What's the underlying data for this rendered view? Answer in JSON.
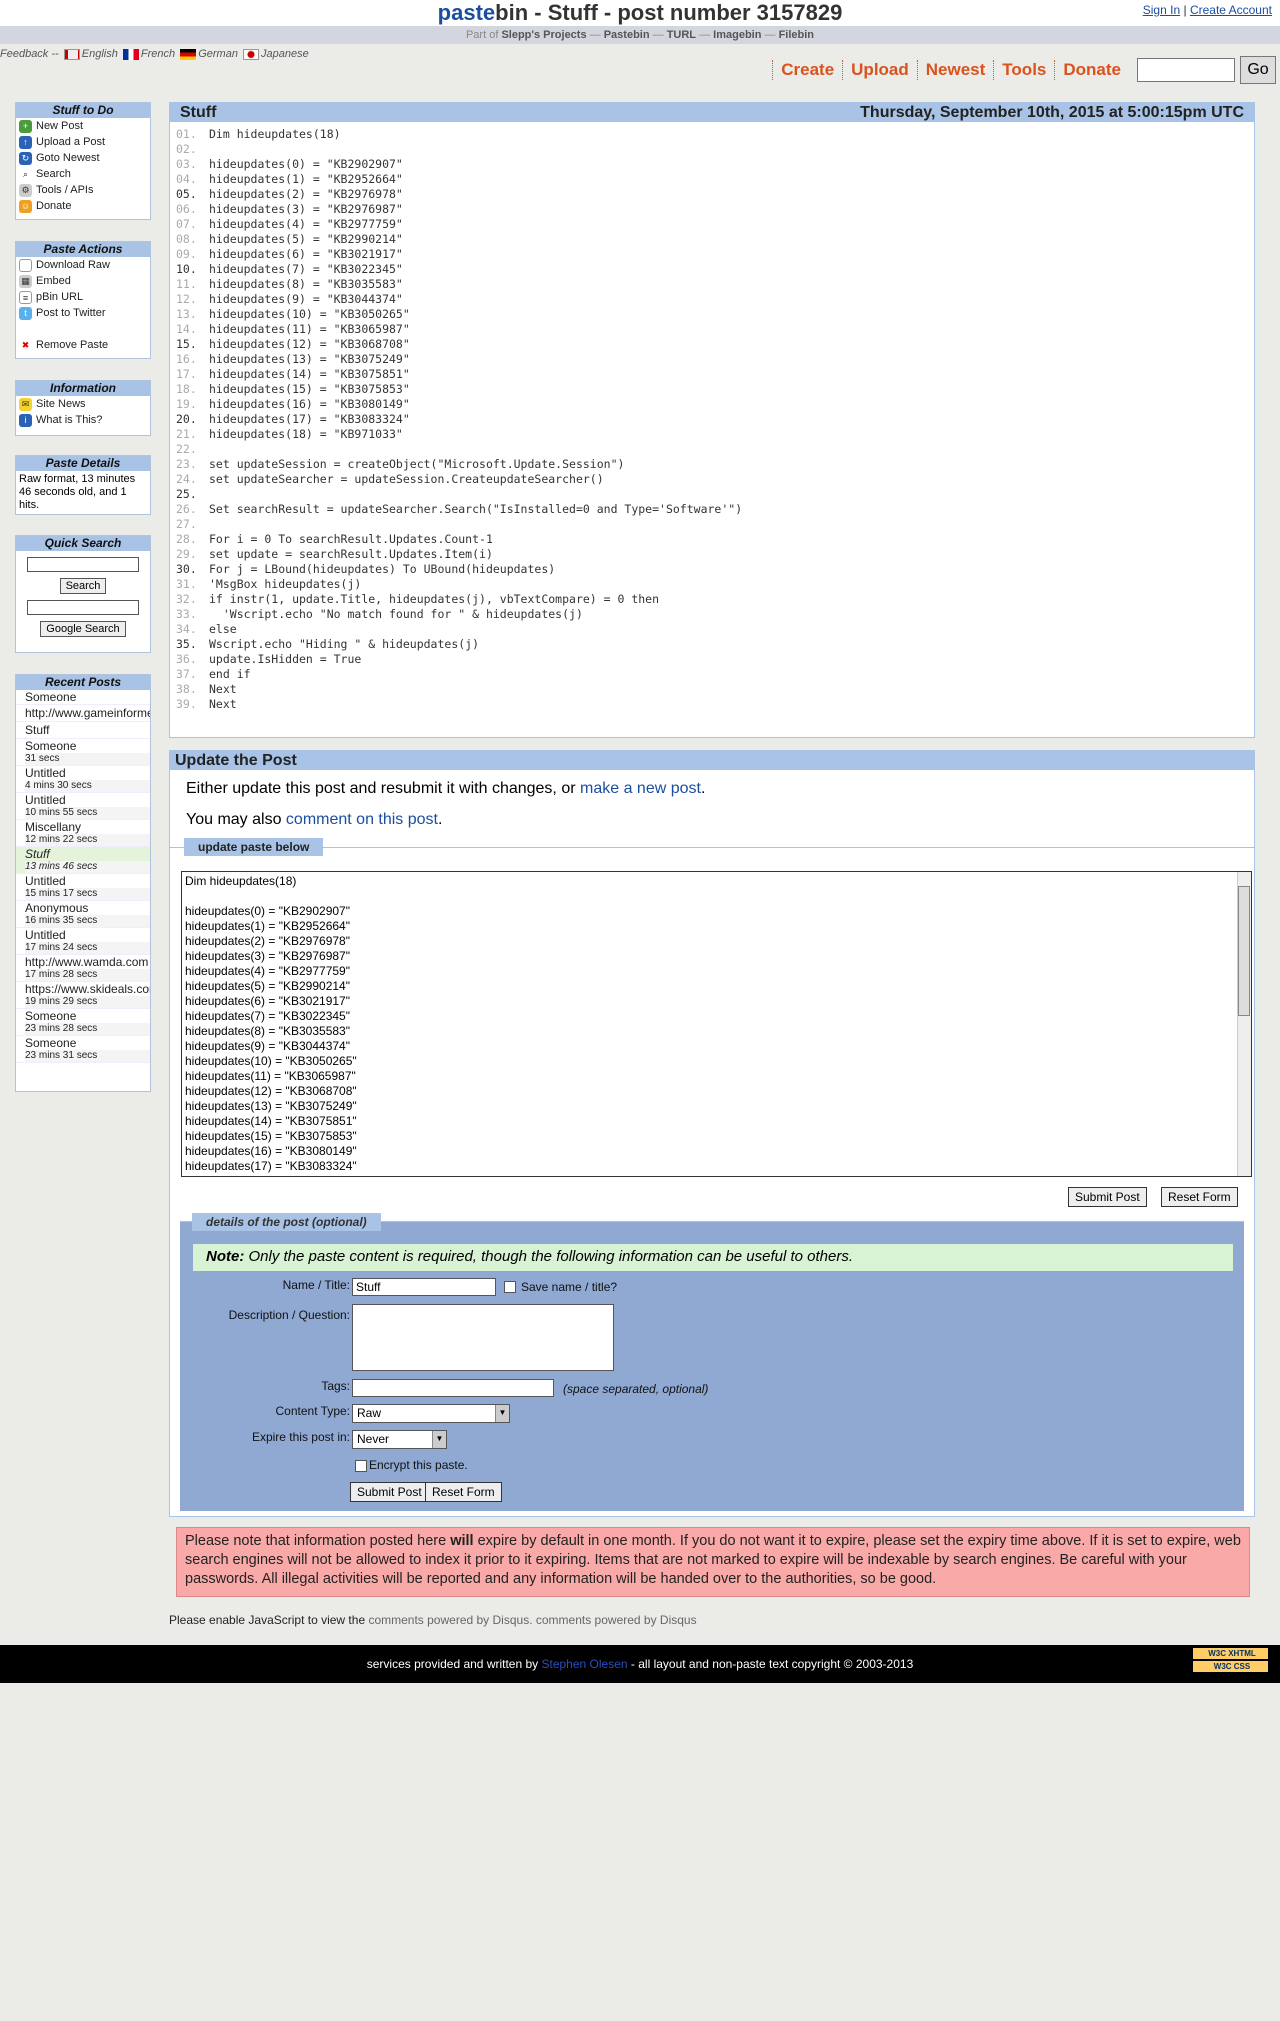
{
  "header": {
    "brand_pa": "paste",
    "brand_bin": "bin",
    "title_rest": " - Stuff - post number 3157829",
    "sign_in": "Sign In",
    "sep": "|",
    "create_account": "Create Account"
  },
  "partbar": {
    "prefix": "Part of",
    "projects": "Slepp's Projects",
    "dash": "—",
    "links": [
      "Pastebin",
      "TURL",
      "Imagebin",
      "Filebin"
    ]
  },
  "langs": {
    "feedback": "Feedback --",
    "items": [
      "English",
      "French",
      "German",
      "Japanese"
    ]
  },
  "topnav": {
    "items": [
      "Create",
      "Upload",
      "Newest",
      "Tools",
      "Donate"
    ],
    "go": "Go"
  },
  "sidebar": {
    "stuff_title": "Stuff to Do",
    "stuff": [
      "New Post",
      "Upload a Post",
      "Goto Newest",
      "Search",
      "Tools / APIs",
      "Donate"
    ],
    "actions_title": "Paste Actions",
    "actions": [
      "Download Raw",
      "Embed",
      "pBin URL",
      "Post to Twitter",
      "Remove Paste"
    ],
    "info_title": "Information",
    "info": [
      "Site News",
      "What is This?"
    ],
    "details_title": "Paste Details",
    "details_text": "Raw format, 13 minutes 46 seconds old, and 1 hits.",
    "qs_title": "Quick Search",
    "search_btn": "Search",
    "google_btn": "Google Search",
    "recent_title": "Recent Posts",
    "recent": [
      {
        "title": "Someone",
        "ago": ""
      },
      {
        "title": "http://www.gameinformer.com",
        "ago": ""
      },
      {
        "title": "Stuff",
        "ago": ""
      },
      {
        "title": "Someone",
        "ago": "31 secs"
      },
      {
        "title": "Untitled",
        "ago": "4 mins 30 secs"
      },
      {
        "title": "Untitled",
        "ago": "10 mins 55 secs"
      },
      {
        "title": "Miscellany",
        "ago": "12 mins 22 secs"
      },
      {
        "title": "Stuff",
        "ago": "13 mins 46 secs"
      },
      {
        "title": "Untitled",
        "ago": "15 mins 17 secs"
      },
      {
        "title": "Anonymous",
        "ago": "16 mins 35 secs"
      },
      {
        "title": "Untitled",
        "ago": "17 mins 24 secs"
      },
      {
        "title": "http://www.wamda.com",
        "ago": "17 mins 28 secs"
      },
      {
        "title": "https://www.skideals.com",
        "ago": "19 mins 29 secs"
      },
      {
        "title": "Someone",
        "ago": "23 mins 28 secs"
      },
      {
        "title": "Someone",
        "ago": "23 mins 31 secs"
      }
    ]
  },
  "paste": {
    "title": "Stuff",
    "date": "Thursday, September 10th, 2015 at 5:00:15pm UTC",
    "lines": [
      "Dim hideupdates(18)",
      "",
      "hideupdates(0) = \"KB2902907\"",
      "hideupdates(1) = \"KB2952664\"",
      "hideupdates(2) = \"KB2976978\"",
      "hideupdates(3) = \"KB2976987\"",
      "hideupdates(4) = \"KB2977759\"",
      "hideupdates(5) = \"KB2990214\"",
      "hideupdates(6) = \"KB3021917\"",
      "hideupdates(7) = \"KB3022345\"",
      "hideupdates(8) = \"KB3035583\"",
      "hideupdates(9) = \"KB3044374\"",
      "hideupdates(10) = \"KB3050265\"",
      "hideupdates(11) = \"KB3065987\"",
      "hideupdates(12) = \"KB3068708\"",
      "hideupdates(13) = \"KB3075249\"",
      "hideupdates(14) = \"KB3075851\"",
      "hideupdates(15) = \"KB3075853\"",
      "hideupdates(16) = \"KB3080149\"",
      "hideupdates(17) = \"KB3083324\"",
      "hideupdates(18) = \"KB971033\"",
      "",
      "set updateSession = createObject(\"Microsoft.Update.Session\")",
      "set updateSearcher = updateSession.CreateupdateSearcher()",
      "",
      "Set searchResult = updateSearcher.Search(\"IsInstalled=0 and Type='Software'\")",
      "",
      "For i = 0 To searchResult.Updates.Count-1",
      "set update = searchResult.Updates.Item(i)",
      "For j = LBound(hideupdates) To UBound(hideupdates)",
      "'MsgBox hideupdates(j)",
      "if instr(1, update.Title, hideupdates(j), vbTextCompare) = 0 then",
      "  'Wscript.echo \"No match found for \" & hideupdates(j)",
      "else",
      "Wscript.echo \"Hiding \" & hideupdates(j)",
      "update.IsHidden = True",
      "end if",
      "Next",
      "Next"
    ]
  },
  "update": {
    "title": "Update the Post",
    "line1_pre": "Either update this post and resubmit it with changes, or ",
    "line1_link": "make a new post",
    "line1_post": ".",
    "line2_pre": "You may also ",
    "line2_link": "comment on this post",
    "line2_post": ".",
    "legend": "update paste below",
    "textarea": "Dim hideupdates(18)\n\nhideupdates(0) = \"KB2902907\"\nhideupdates(1) = \"KB2952664\"\nhideupdates(2) = \"KB2976978\"\nhideupdates(3) = \"KB2976987\"\nhideupdates(4) = \"KB2977759\"\nhideupdates(5) = \"KB2990214\"\nhideupdates(6) = \"KB3021917\"\nhideupdates(7) = \"KB3022345\"\nhideupdates(8) = \"KB3035583\"\nhideupdates(9) = \"KB3044374\"\nhideupdates(10) = \"KB3050265\"\nhideupdates(11) = \"KB3065987\"\nhideupdates(12) = \"KB3068708\"\nhideupdates(13) = \"KB3075249\"\nhideupdates(14) = \"KB3075851\"\nhideupdates(15) = \"KB3075853\"\nhideupdates(16) = \"KB3080149\"\nhideupdates(17) = \"KB3083324\"",
    "submit": "Submit Post",
    "reset": "Reset Form"
  },
  "details": {
    "legend": "details of the post (optional)",
    "note_bold": "Note:",
    "note_text": " Only the paste content is required, though the following information can be useful to others.",
    "name_label": "Name / Title:",
    "name_value": "Stuff",
    "save_label": "Save name / title?",
    "desc_label": "Description / Question:",
    "tags_label": "Tags:",
    "tags_hint": "(space separated, optional)",
    "ctype_label": "Content Type:",
    "ctype_value": "Raw",
    "expire_label": "Expire this post in:",
    "expire_value": "Never",
    "encrypt_label": "Encrypt this paste.",
    "submit": "Submit Post",
    "reset": "Reset Form"
  },
  "warning": {
    "pre": "Please note that information posted here ",
    "bold": "will",
    "post": " expire by default in one month. If you do not want it to expire, please set the expiry time above. If it is set to expire, web search engines will not be allowed to index it prior to it expiring. Items that are not marked to expire will be indexable by search engines. Be careful with your passwords. All illegal activities will be reported and any information will be handed over to the authorities, so be good."
  },
  "disqus": {
    "pre": "Please enable JavaScript to view the ",
    "link1": "comments powered by Disqus.",
    "link2": "comments powered by Disqus"
  },
  "footer": {
    "pre": "services provided and written by ",
    "author": "Stephen Olesen",
    "post": " - all layout and non-paste text copyright © 2003-2013",
    "badge1": "W3C XHTML",
    "badge2": "W3C CSS"
  }
}
